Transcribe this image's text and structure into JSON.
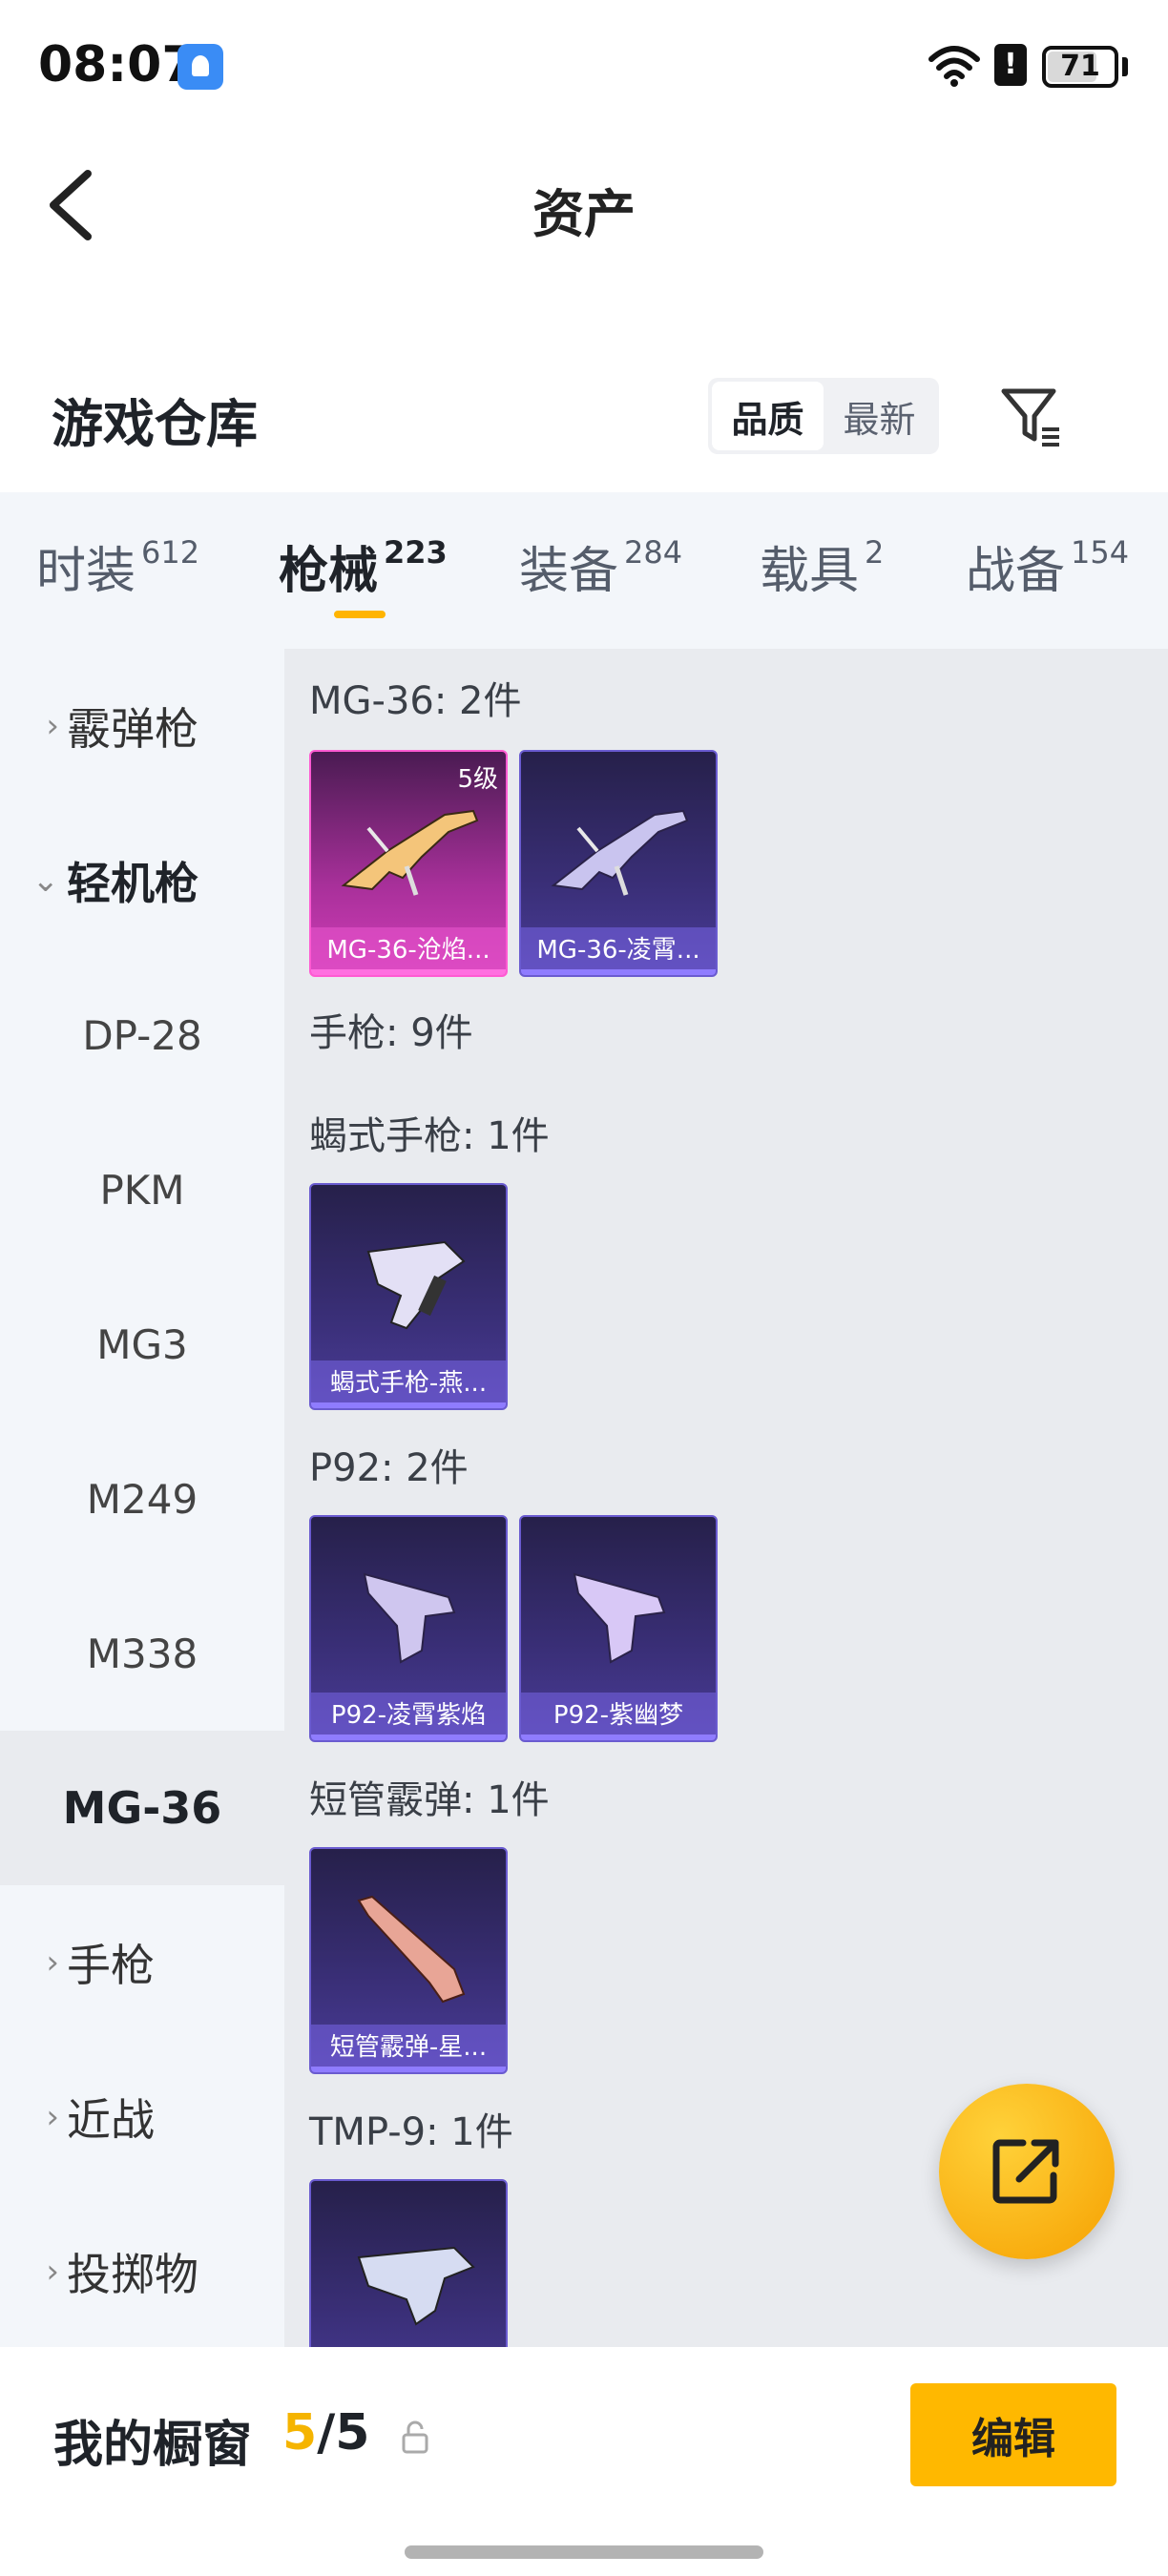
{
  "status_bar": {
    "time": "08:07",
    "battery": "71"
  },
  "header": {
    "title": "资产"
  },
  "warehouse": {
    "title": "游戏仓库",
    "sort_options": [
      "品质",
      "最新"
    ],
    "active_sort": "品质"
  },
  "tabs": [
    {
      "label": "时装",
      "count": "612"
    },
    {
      "label": "枪械",
      "count": "223",
      "active": true
    },
    {
      "label": "装备",
      "count": "284"
    },
    {
      "label": "载具",
      "count": "2"
    },
    {
      "label": "战备",
      "count": "154"
    }
  ],
  "sidenav": [
    {
      "label": "霰弹枪",
      "type": "parent",
      "expanded": false
    },
    {
      "label": "轻机枪",
      "type": "parent",
      "expanded": true
    },
    {
      "label": "DP-28",
      "type": "child"
    },
    {
      "label": "PKM",
      "type": "child"
    },
    {
      "label": "MG3",
      "type": "child"
    },
    {
      "label": "M249",
      "type": "child"
    },
    {
      "label": "M338",
      "type": "child"
    },
    {
      "label": "MG-36",
      "type": "child",
      "selected": true
    },
    {
      "label": "手枪",
      "type": "parent",
      "expanded": false
    },
    {
      "label": "近战",
      "type": "parent",
      "expanded": false
    },
    {
      "label": "投掷物",
      "type": "parent",
      "expanded": false
    }
  ],
  "groups": [
    {
      "title": "MG-36: 2件",
      "items": [
        {
          "name": "MG-36-沧焰...",
          "level": "5级",
          "rarity": "pink"
        },
        {
          "name": "MG-36-凌霄...",
          "rarity": "purple"
        }
      ]
    },
    {
      "title": "手枪: 9件",
      "items": []
    },
    {
      "title": "蝎式手枪: 1件",
      "items": [
        {
          "name": "蝎式手枪-燕...",
          "rarity": "purple"
        }
      ]
    },
    {
      "title": "P92: 2件",
      "items": [
        {
          "name": "P92-凌霄紫焰",
          "rarity": "purple"
        },
        {
          "name": "P92-紫幽梦",
          "rarity": "purple"
        }
      ]
    },
    {
      "title": "短管霰弹: 1件",
      "items": [
        {
          "name": "短管霰弹-星...",
          "rarity": "purple"
        }
      ]
    },
    {
      "title": "TMP-9: 1件",
      "items": [
        {
          "name": "",
          "rarity": "purple"
        }
      ]
    }
  ],
  "bottom": {
    "showcase_label": "我的橱窗",
    "showcase_current": "5",
    "showcase_sep": "/",
    "showcase_total": "5",
    "edit_label": "编辑"
  },
  "colors": {
    "accent": "#ffb800",
    "pink_rarity": "#d23db8",
    "purple_rarity": "#4a3c98"
  },
  "icons": [
    "back-arrow-icon",
    "filter-icon",
    "share-icon",
    "lock-icon",
    "wifi-icon",
    "battery-icon"
  ]
}
